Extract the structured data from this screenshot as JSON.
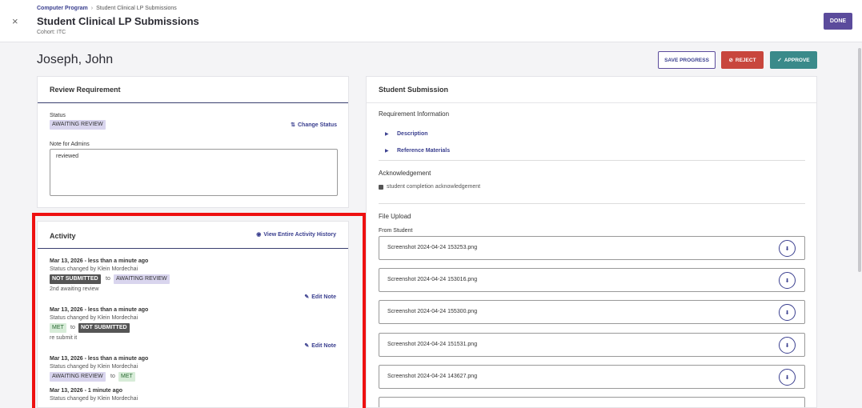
{
  "header": {
    "breadcrumb_link": "Computer Program",
    "breadcrumb_sep": "›",
    "breadcrumb_current": "Student Clinical LP Submissions",
    "title": "Student Clinical LP Submissions",
    "cohort": "Cohort: ITC",
    "done_label": "DONE",
    "close_glyph": "×"
  },
  "student": {
    "name": "Joseph, John"
  },
  "actions": {
    "save": "SAVE PROGRESS",
    "reject": "REJECT",
    "approve": "APPROVE"
  },
  "review": {
    "title": "Review Requirement",
    "status_label": "Status",
    "status_value": "AWAITING REVIEW",
    "change_status": "Change Status",
    "note_label": "Note for Admins",
    "note_value": "reviewed"
  },
  "activity": {
    "title": "Activity",
    "view_history": "View Entire Activity History",
    "edit_note": "Edit Note",
    "to_word": "to",
    "entries": [
      {
        "date": "Mar 13, 2026 - less than a minute ago",
        "changed_by": "Status changed by Klein Mordechai",
        "from": "NOT SUBMITTED",
        "to": "AWAITING REVIEW",
        "note": "2nd awaiting review"
      },
      {
        "date": "Mar 13, 2026 - less than a minute ago",
        "changed_by": "Status changed by Klein Mordechai",
        "from": "MET",
        "to": "NOT SUBMITTED",
        "note": "re submit it"
      },
      {
        "date": "Mar 13, 2026 - less than a minute ago",
        "changed_by": "Status changed by Klein Mordechai",
        "from": "AWAITING REVIEW",
        "to": "MET",
        "note": ""
      },
      {
        "date": "Mar 13, 2026 - 1 minute ago",
        "changed_by": "Status changed by Klein Mordechai"
      }
    ]
  },
  "submission": {
    "title": "Student Submission",
    "req_info_title": "Requirement Information",
    "description": "Description",
    "reference": "Reference Materials",
    "ack_title": "Acknowledgement",
    "ack_item": "student completion acknowledgement",
    "upload_title": "File Upload",
    "from_student": "From Student",
    "files": [
      "Screenshot 2024-04-24 153253.png",
      "Screenshot 2024-04-24 153016.png",
      "Screenshot 2024-04-24 155300.png",
      "Screenshot 2024-04-24 151531.png",
      "Screenshot 2024-04-24 143627.png"
    ]
  },
  "colors": {
    "primary": "#5b4b9c",
    "reject": "#c8463d",
    "approve": "#3a8a8a",
    "highlight": "#e11111"
  }
}
